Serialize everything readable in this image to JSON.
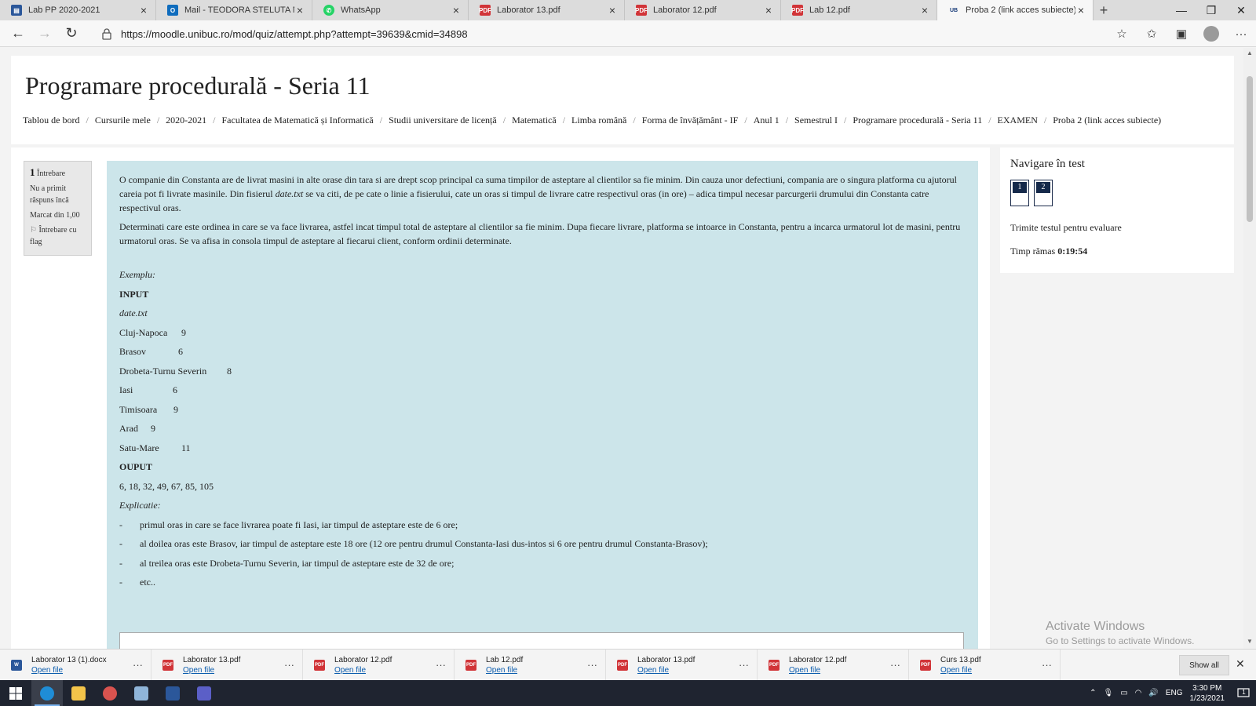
{
  "browser": {
    "tabs": [
      {
        "title": "Lab PP 2020-2021",
        "icon": "forms-icon",
        "color": "#2b579a",
        "active": false
      },
      {
        "title": "Mail - TEODORA STELUTA NICU",
        "icon": "outlook-icon",
        "color": "#0f6cbd",
        "active": false
      },
      {
        "title": "WhatsApp",
        "icon": "whatsapp-icon",
        "color": "#25d366",
        "active": false
      },
      {
        "title": "Laborator 13.pdf",
        "icon": "pdf-icon",
        "color": "#d13438",
        "active": false
      },
      {
        "title": "Laborator 12.pdf",
        "icon": "pdf-icon",
        "color": "#d13438",
        "active": false
      },
      {
        "title": "Lab 12.pdf",
        "icon": "pdf-icon",
        "color": "#d13438",
        "active": false
      },
      {
        "title": "Proba 2 (link acces subiecte)",
        "icon": "unibuc-icon",
        "color": "#f7f7f7",
        "active": true
      }
    ],
    "url": "https://moodle.unibuc.ro/mod/quiz/attempt.php?attempt=39639&cmid=34898"
  },
  "page": {
    "course_title": "Programare procedurală - Seria 11",
    "breadcrumb": [
      "Tablou de bord",
      "Cursurile mele",
      "2020-2021",
      "Facultatea de Matematică și Informatică",
      "Studii universitare de licență",
      "Matematică",
      "Limba română",
      "Forma de învățământ - IF",
      "Anul 1",
      "Semestrul I",
      "Programare procedurală - Seria 11",
      "EXAMEN",
      "Proba 2 (link acces subiecte)"
    ]
  },
  "question_info": {
    "number": "1",
    "label": "Întrebare",
    "status": "Nu a primit răspuns încă",
    "marks": "Marcat din 1,00",
    "flag": "Întrebare cu flag"
  },
  "question": {
    "p1_a": "O companie din Constanta are de livrat masini in alte orase din tara si are drept scop principal ca suma timpilor de asteptare al clientilor sa fie minim. Din cauza unor defectiuni, compania are o singura platforma cu ajutorul careia pot fi livrate masinile. Din fisierul ",
    "p1_file": "date.txt",
    "p1_b": " se va citi, de pe cate o linie a fisierului, cate un oras si timpul de livrare catre respectivul oras (in ore) – adica timpul necesar parcurgerii drumului din Constanta catre respectivul oras.",
    "p2": "Determinati care este ordinea in care se va face livrarea, astfel incat timpul total de asteptare al clientilor sa fie minim. Dupa fiecare livrare, platforma se intoarce in Constanta, pentru a incarca urmatorul lot de masini, pentru urmatorul oras. Se va afisa in consola timpul de asteptare al fiecarui client, conform ordinii determinate.",
    "example_label": "Exemplu:",
    "input_label": "INPUT",
    "input_file": "date.txt",
    "cities": [
      {
        "name": "Cluj-Napoca",
        "hours": "9"
      },
      {
        "name": "Brasov",
        "hours": "6"
      },
      {
        "name": "Drobeta-Turnu Severin",
        "hours": "8"
      },
      {
        "name": "Iasi",
        "hours": "6"
      },
      {
        "name": "Timisoara",
        "hours": "9"
      },
      {
        "name": "Arad",
        "hours": "9"
      },
      {
        "name": "Satu-Mare",
        "hours": "11"
      }
    ],
    "output_label": "OUPUT",
    "output_value": "6, 18, 32, 49, 67, 85, 105",
    "explanation_label": "Explicatie:",
    "bullets": [
      "primul oras in care se face livrarea poate fi Iasi, iar timpul de asteptare este de 6 ore;",
      "al doilea oras este Brasov, iar timpul de asteptare este 18 ore (12 ore pentru drumul Constanta-Iasi dus-intos si 6 ore pentru drumul Constanta-Brasov);",
      "al treilea oras este Drobeta-Turnu Severin, iar timpul de asteptare este de 32 de ore;",
      "etc.."
    ],
    "bullet_char": "-"
  },
  "navigation": {
    "title": "Navigare în test",
    "buttons": [
      "1",
      "2"
    ],
    "submit": "Trimite testul pentru evaluare",
    "time_label": "Timp rămas",
    "time_value": "0:19:54"
  },
  "watermark": {
    "line1": "Activate Windows",
    "line2": "Go to Settings to activate Windows."
  },
  "downloads": {
    "items": [
      {
        "name": "Laborator 13 (1).docx",
        "type": "docx-icon",
        "color": "#2b579a"
      },
      {
        "name": "Laborator 13.pdf",
        "type": "pdf-icon",
        "color": "#d13438"
      },
      {
        "name": "Laborator 12.pdf",
        "type": "pdf-icon",
        "color": "#d13438"
      },
      {
        "name": "Lab 12.pdf",
        "type": "pdf-icon",
        "color": "#d13438"
      },
      {
        "name": "Laborator 13.pdf",
        "type": "pdf-icon",
        "color": "#d13438"
      },
      {
        "name": "Laborator 12.pdf",
        "type": "pdf-icon",
        "color": "#d13438"
      },
      {
        "name": "Curs 13.pdf",
        "type": "pdf-icon",
        "color": "#d13438"
      }
    ],
    "open_label": "Open file",
    "show_all": "Show all"
  },
  "taskbar": {
    "apps": [
      {
        "name": "edge-icon",
        "color": "#1f8dd6",
        "active": true
      },
      {
        "name": "file-explorer-icon",
        "color": "#f3c44a",
        "active": false
      },
      {
        "name": "settings-app-icon",
        "color": "#d9534f",
        "active": false
      },
      {
        "name": "notes-app-icon",
        "color": "#8fb5d9",
        "active": false
      },
      {
        "name": "word-icon",
        "color": "#2b579a",
        "active": false
      },
      {
        "name": "teams-icon",
        "color": "#5b5fc7",
        "active": false
      }
    ],
    "language": "ENG",
    "time": "3:30 PM",
    "date": "1/23/2021",
    "notification_count": "1"
  }
}
